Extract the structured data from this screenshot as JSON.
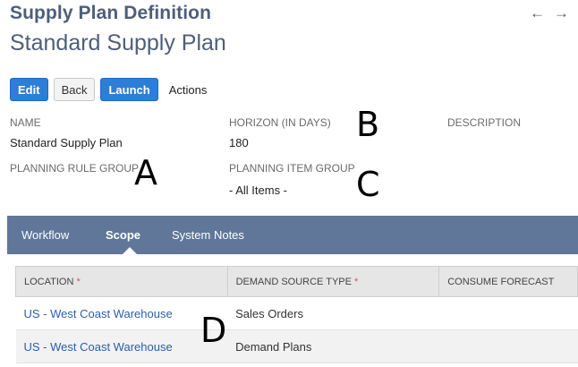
{
  "header": {
    "page_type": "Supply Plan Definition",
    "record_title": "Standard Supply Plan",
    "nav_back": "←",
    "nav_forward": "→"
  },
  "buttons": {
    "edit": "Edit",
    "back": "Back",
    "launch": "Launch",
    "actions": "Actions"
  },
  "fields": {
    "name_label": "NAME",
    "name_value": "Standard Supply Plan",
    "horizon_label": "HORIZON (IN DAYS)",
    "horizon_value": "180",
    "description_label": "DESCRIPTION",
    "planning_rule_group_label": "PLANNING RULE GROUP",
    "planning_item_group_label": "PLANNING ITEM GROUP",
    "planning_item_group_value": "- All Items -"
  },
  "annotations": {
    "a": "A",
    "b": "B",
    "c": "C",
    "d": "D"
  },
  "tabs": [
    {
      "label": "Workflow"
    },
    {
      "label": "Scope"
    },
    {
      "label": "System Notes"
    }
  ],
  "table": {
    "columns": [
      "LOCATION",
      "DEMAND SOURCE TYPE",
      "CONSUME FORECAST"
    ],
    "required_marker": "*",
    "rows": [
      {
        "location": "US - West Coast Warehouse",
        "demand_source_type": "Sales Orders"
      },
      {
        "location": "US - West Coast Warehouse",
        "demand_source_type": "Demand Plans"
      }
    ]
  }
}
